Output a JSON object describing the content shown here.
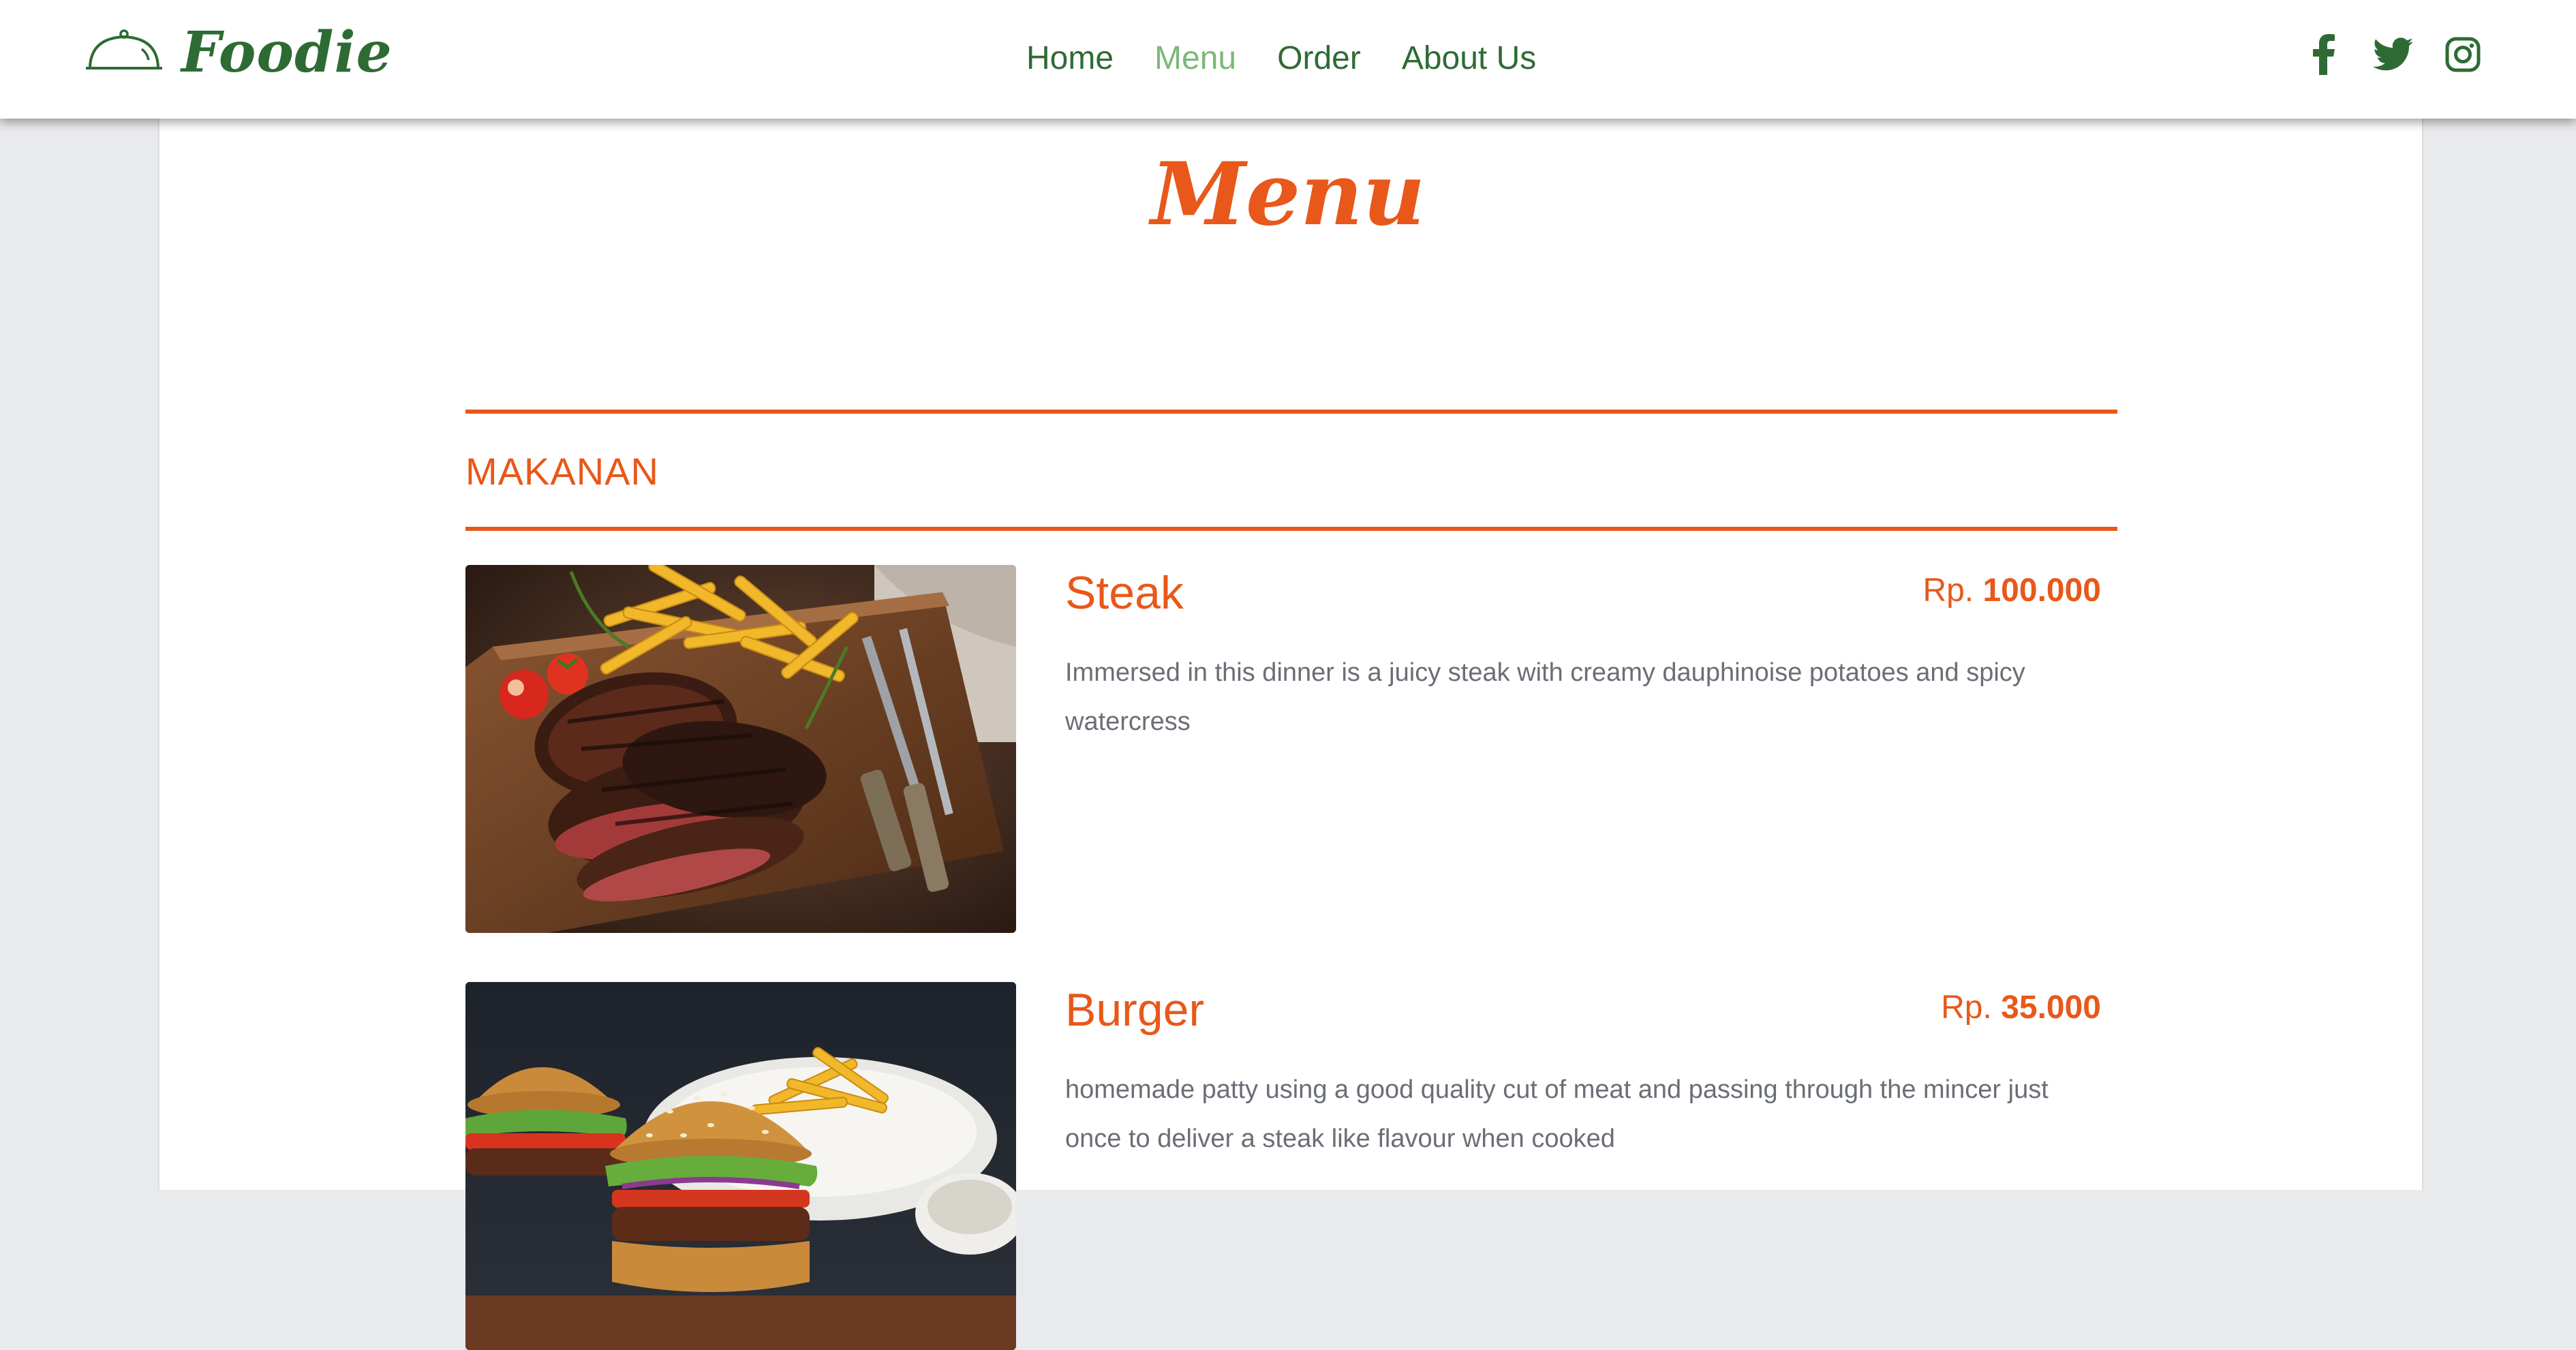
{
  "brand": {
    "name": "Foodie",
    "logo_icon": "cloche-icon",
    "color": "#2e6b34"
  },
  "nav": {
    "items": [
      {
        "label": "Home",
        "active": false
      },
      {
        "label": "Menu",
        "active": true
      },
      {
        "label": "Order",
        "active": false
      },
      {
        "label": "About Us",
        "active": false
      }
    ],
    "active_color": "#7cb878"
  },
  "socials": [
    {
      "icon": "facebook-icon"
    },
    {
      "icon": "twitter-icon"
    },
    {
      "icon": "instagram-icon"
    }
  ],
  "page": {
    "title": "Menu",
    "accent_color": "#e8581a"
  },
  "section": {
    "title": "MAKANAN"
  },
  "menu_items": [
    {
      "name": "Steak",
      "price_prefix": "Rp.",
      "price": "100.000",
      "description": "Immersed in this dinner is a juicy steak with creamy dauphinoise potatoes and spicy watercress"
    },
    {
      "name": "Burger",
      "price_prefix": "Rp.",
      "price": "35.000",
      "description": "homemade patty using a good quality cut of meat and passing through the mincer just once to deliver a steak like flavour when cooked"
    }
  ]
}
